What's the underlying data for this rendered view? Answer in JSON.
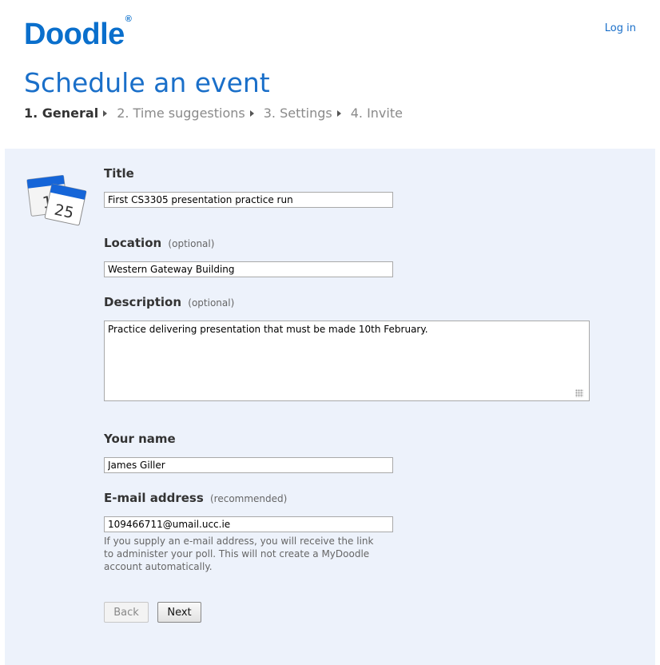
{
  "header": {
    "logo_text": "Doodle",
    "logo_registered": "®",
    "login_label": "Log in",
    "page_title": "Schedule an event",
    "steps": [
      {
        "label": "1. General",
        "active": true
      },
      {
        "label": "2. Time suggestions",
        "active": false
      },
      {
        "label": "3. Settings",
        "active": false
      },
      {
        "label": "4. Invite",
        "active": false
      }
    ]
  },
  "form": {
    "calendar_icon_numbers": [
      "1",
      "25"
    ],
    "title": {
      "label": "Title",
      "value": "First CS3305 presentation practice run"
    },
    "location": {
      "label": "Location",
      "optional": "(optional)",
      "value": "Western Gateway Building"
    },
    "description": {
      "label": "Description",
      "optional": "(optional)",
      "value": "Practice delivering presentation that must be made 10th February."
    },
    "name": {
      "label": "Your name",
      "value": "James Giller"
    },
    "email": {
      "label": "E-mail address",
      "optional": "(recommended)",
      "value": "109466711@umail.ucc.ie",
      "hint": "If you supply an e-mail address, you will receive the link to administer your poll. This will not create a MyDoodle account automatically."
    },
    "buttons": {
      "back": "Back",
      "next": "Next"
    }
  },
  "colors": {
    "accent": "#1a6fc9",
    "form_background": "#edf2fb"
  }
}
